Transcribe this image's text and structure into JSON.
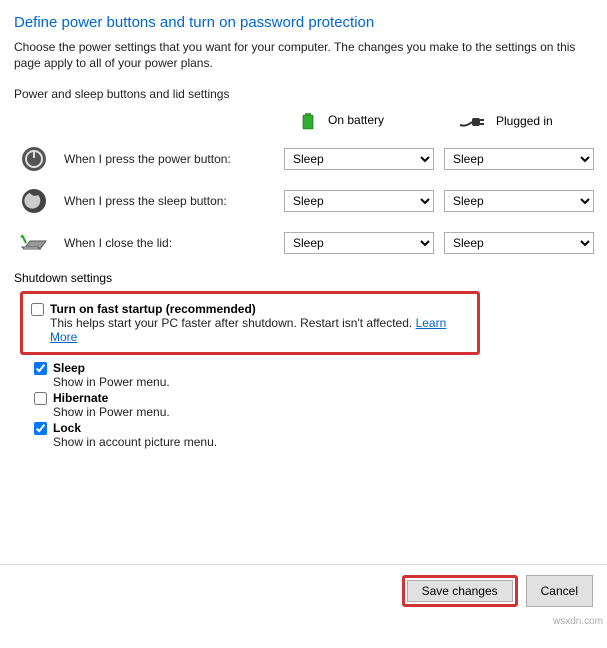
{
  "title": "Define power buttons and turn on password protection",
  "description": "Choose the power settings that you want for your computer. The changes you make to the settings on this page apply to all of your power plans.",
  "buttons_section_label": "Power and sleep buttons and lid settings",
  "columns": {
    "battery": "On battery",
    "plugged": "Plugged in"
  },
  "rows": {
    "power": {
      "label": "When I press the power button:",
      "battery": "Sleep",
      "plugged": "Sleep"
    },
    "sleep": {
      "label": "When I press the sleep button:",
      "battery": "Sleep",
      "plugged": "Sleep"
    },
    "lid": {
      "label": "When I close the lid:",
      "battery": "Sleep",
      "plugged": "Sleep"
    }
  },
  "shutdown_label": "Shutdown settings",
  "fast": {
    "title": "Turn on fast startup (recommended)",
    "sub": "This helps start your PC faster after shutdown. Restart isn't affected. ",
    "learn": "Learn More",
    "checked": false
  },
  "sleep_opt": {
    "title": "Sleep",
    "sub": "Show in Power menu.",
    "checked": true
  },
  "hibernate_opt": {
    "title": "Hibernate",
    "sub": "Show in Power menu.",
    "checked": false
  },
  "lock_opt": {
    "title": "Lock",
    "sub": "Show in account picture menu.",
    "checked": true
  },
  "footer": {
    "save": "Save changes",
    "cancel": "Cancel"
  },
  "watermark": "wsxdn.com"
}
